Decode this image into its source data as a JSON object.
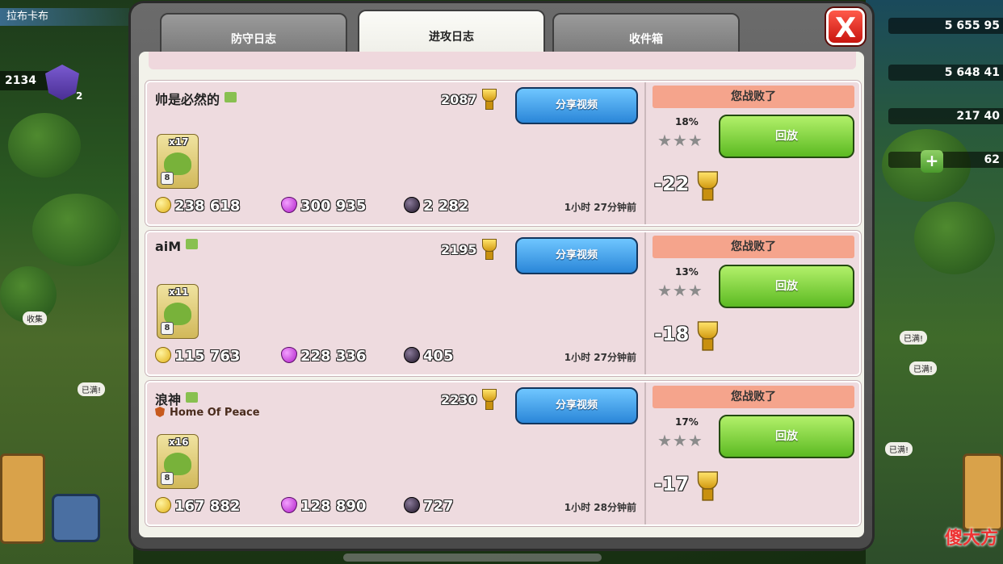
{
  "hud": {
    "player_name": "拉布卡布",
    "trophies": "2134",
    "level": "2",
    "resources": [
      "5 655 95",
      "5 648 41",
      "217 40",
      "62"
    ],
    "collect_label": "收集",
    "full_label_1": "已满!",
    "full_label_2": "已满!",
    "full_label_3": "已满!",
    "full_label_4": "已满!"
  },
  "tabs": [
    {
      "label": "防守日志",
      "active": false
    },
    {
      "label": "进攻日志",
      "active": true
    },
    {
      "label": "收件箱",
      "active": false
    }
  ],
  "close_label": "X",
  "attacks": [
    {
      "opponent": "帅是必然的",
      "clan": "",
      "trophies": "2087",
      "share_label": "分享视频",
      "troop_count": "x17",
      "troop_level": "8",
      "gold": "238 618",
      "elixir": "300 935",
      "dark_elixir": "2 282",
      "time_ago": "1小时 27分钟前",
      "result": "您战败了",
      "destruction": "18%",
      "stars": "★★★",
      "replay_label": "回放",
      "trophy_change": "-22"
    },
    {
      "opponent": "aiM",
      "clan": "",
      "trophies": "2195",
      "share_label": "分享视频",
      "troop_count": "x11",
      "troop_level": "8",
      "gold": "115 763",
      "elixir": "228 336",
      "dark_elixir": "405",
      "time_ago": "1小时 27分钟前",
      "result": "您战败了",
      "destruction": "13%",
      "stars": "★★★",
      "replay_label": "回放",
      "trophy_change": "-18"
    },
    {
      "opponent": "浪神",
      "clan": "Home Of Peace",
      "trophies": "2230",
      "share_label": "分享视频",
      "troop_count": "x16",
      "troop_level": "8",
      "gold": "167 882",
      "elixir": "128 890",
      "dark_elixir": "727",
      "time_ago": "1小时 28分钟前",
      "result": "您战败了",
      "destruction": "17%",
      "stars": "★★★",
      "replay_label": "回放",
      "trophy_change": "-17"
    }
  ],
  "watermark": "傻大方"
}
